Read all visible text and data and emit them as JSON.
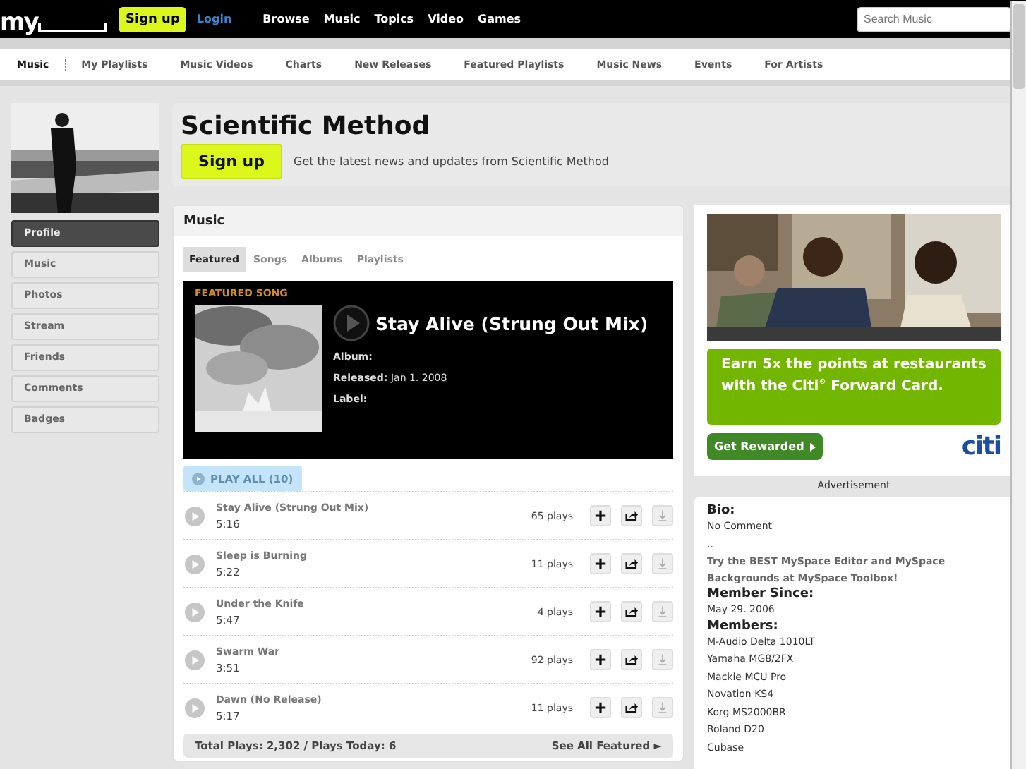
{
  "topbar": {
    "logo": "my",
    "signup": "Sign up",
    "login": "Login",
    "links": [
      "Browse",
      "Music",
      "Topics",
      "Video",
      "Games"
    ],
    "search": {
      "placeholder": "Search Music"
    }
  },
  "subnav": [
    {
      "label": "Music",
      "selected": true
    },
    {
      "label": "My Playlists",
      "selected": false
    },
    {
      "label": "Music Videos",
      "selected": false
    },
    {
      "label": "Charts",
      "selected": false
    },
    {
      "label": "New Releases",
      "selected": false
    },
    {
      "label": "Featured Playlists",
      "selected": false
    },
    {
      "label": "Music News",
      "selected": false
    },
    {
      "label": "Events",
      "selected": false
    },
    {
      "label": "For Artists",
      "selected": false
    }
  ],
  "sidebar": {
    "items": [
      {
        "label": "Profile",
        "selected": true
      },
      {
        "label": "Music",
        "selected": false
      },
      {
        "label": "Photos",
        "selected": false
      },
      {
        "label": "Stream",
        "selected": false
      },
      {
        "label": "Friends",
        "selected": false
      },
      {
        "label": "Comments",
        "selected": false
      },
      {
        "label": "Badges",
        "selected": false
      }
    ]
  },
  "header": {
    "title": "Scientific Method",
    "signup": "Sign up",
    "tagline": "Get the latest news and updates from Scientific Method"
  },
  "music": {
    "title": "Music",
    "tabs": [
      {
        "label": "Featured",
        "selected": true
      },
      {
        "label": "Songs",
        "selected": false
      },
      {
        "label": "Albums",
        "selected": false
      },
      {
        "label": "Playlists",
        "selected": false
      }
    ],
    "featured": {
      "heading": "FEATURED SONG",
      "title": "Stay Alive (Strung Out Mix)",
      "fields": [
        {
          "label": "Album:"
        },
        {
          "label": "Released:",
          "value": "Jan 1. 2008"
        },
        {
          "label": "Label:"
        }
      ]
    },
    "play_all": {
      "label": "PLAY ALL (10)",
      "disabled": true
    },
    "tracks": [
      {
        "title": "Stay Alive (Strung Out Mix)",
        "duration": "5:16",
        "plays": "65 plays"
      },
      {
        "title": "Sleep is Burning",
        "duration": "5:22",
        "plays": "11 plays"
      },
      {
        "title": "Under the Knife",
        "duration": "5:47",
        "plays": "4 plays"
      },
      {
        "title": "Swarm War",
        "duration": "3:51",
        "plays": "92 plays"
      },
      {
        "title": "Dawn (No Release)",
        "duration": "5:17",
        "plays": "11 plays"
      }
    ],
    "footer": {
      "totals": "Total Plays: 2,302 / Plays Today: 6",
      "see_all": "See All Featured ►"
    }
  },
  "ad": {
    "headline": "Earn 5x the points at restaurants with the Citi$^{®}$ Forward Card.",
    "cta": "Get Rewarded",
    "brand": "citi",
    "caption": "Advertisement"
  },
  "bio": [
    {
      "kind": "heading",
      "text": "Bio:"
    },
    {
      "kind": "text",
      "text": "No Comment"
    },
    {
      "kind": "text",
      "text": ".."
    },
    {
      "kind": "link",
      "text": "Try the BEST MySpace Editor and MySpace Backgrounds at MySpace Toolbox!"
    },
    {
      "kind": "heading",
      "text": "Member Since:"
    },
    {
      "kind": "text",
      "text": "May 29. 2006"
    },
    {
      "kind": "heading",
      "text": "Members:"
    },
    {
      "kind": "text",
      "text": "M-Audio Delta 1010LT"
    },
    {
      "kind": "text",
      "text": "Yamaha MG8/2FX"
    },
    {
      "kind": "text",
      "text": "Mackie MCU Pro"
    },
    {
      "kind": "text",
      "text": "Novation KS4"
    },
    {
      "kind": "text",
      "text": "Korg MS2000BR"
    },
    {
      "kind": "text",
      "text": "Roland D20"
    },
    {
      "kind": "text",
      "text": "Cubase"
    }
  ]
}
